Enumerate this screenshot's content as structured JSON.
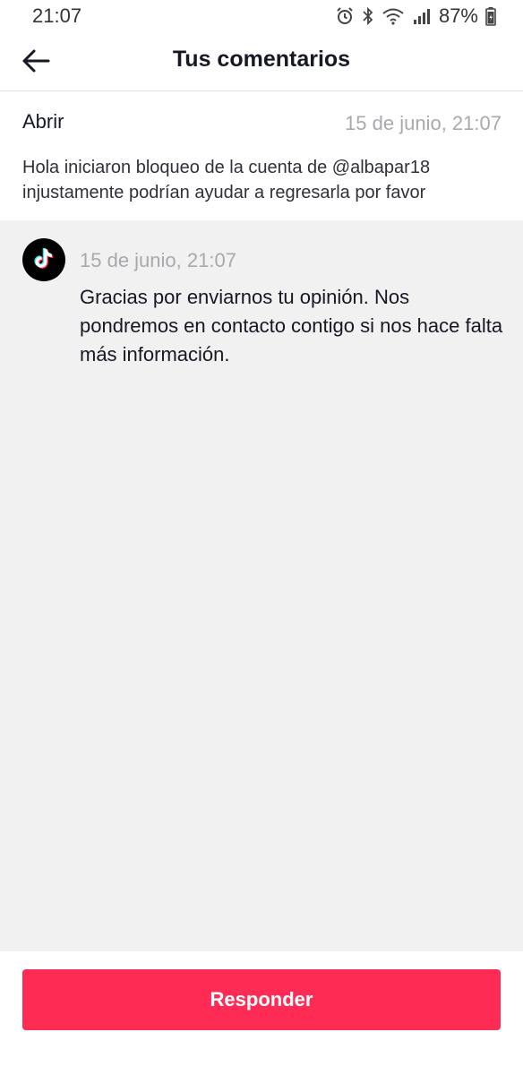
{
  "status_bar": {
    "time": "21:07",
    "battery": "87%",
    "icons": [
      "alarm-icon",
      "bluetooth-icon",
      "wifi-icon",
      "signal-icon",
      "battery-icon"
    ]
  },
  "app_bar": {
    "title": "Tus comentarios",
    "back_icon": "arrow-left-icon"
  },
  "user_comment": {
    "name": "Abrir",
    "timestamp": "15 de junio, 21:07",
    "message": "Hola iniciaron bloqueo de la cuenta de @albapar18 injustamente podrían ayudar a regresarla por favor"
  },
  "reply": {
    "avatar_icon": "tiktok-logo-icon",
    "timestamp": "15 de junio, 21:07",
    "message": "Gracias por enviarnos tu opinión. Nos pondremos en contacto contigo si nos hace falta más información."
  },
  "footer": {
    "respond_label": "Responder"
  },
  "colors": {
    "accent": "#fe2c55",
    "reply_background": "#f1f1f2",
    "muted_text": "#a8a9ad"
  }
}
